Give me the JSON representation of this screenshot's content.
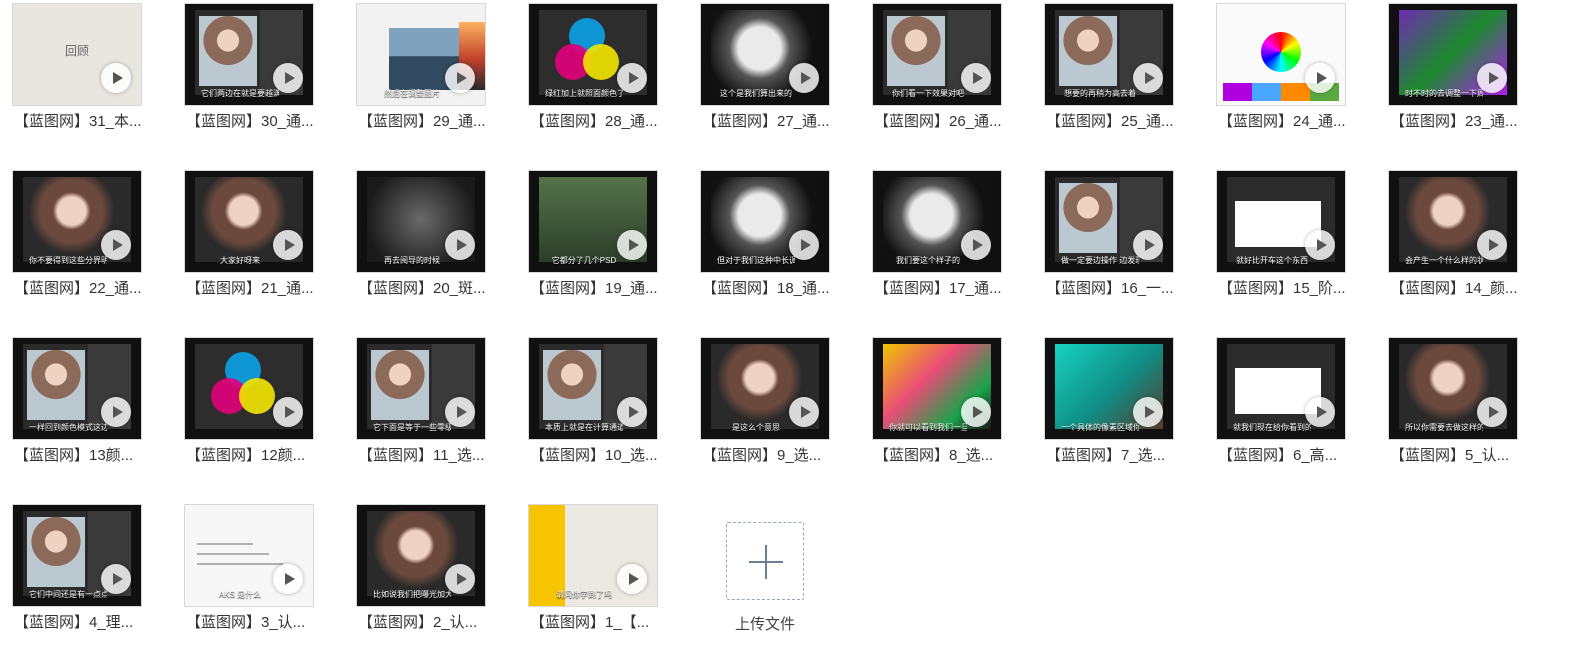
{
  "files": [
    {
      "label": "【蓝图网】31_本...",
      "caption": "",
      "title": "回顾",
      "variant": "v-blank"
    },
    {
      "label": "【蓝图网】30_通...",
      "caption": "它们两边在就是要越满的 越来越薄了",
      "variant": "v-ps"
    },
    {
      "label": "【蓝图网】29_通...",
      "caption": "然后在调整图片",
      "variant": "v-web"
    },
    {
      "label": "【蓝图网】28_通...",
      "caption": "绿红加上就照面颜色了",
      "variant": "v-rgb"
    },
    {
      "label": "【蓝图网】27_通...",
      "caption": "这个是我们算出来的",
      "variant": "v-bw"
    },
    {
      "label": "【蓝图网】26_通...",
      "caption": "你们看一下效果对吧",
      "variant": "v-ps"
    },
    {
      "label": "【蓝图网】25_通...",
      "caption": "想要的再稍为高去着",
      "variant": "v-ps"
    },
    {
      "label": "【蓝图网】24_通...",
      "caption": "",
      "variant": "v-wheel"
    },
    {
      "label": "【蓝图网】23_通...",
      "caption": "时不时的去调整一下周边的颜色",
      "variant": "v-green"
    },
    {
      "label": "【蓝图网】22_通...",
      "caption": "你不要得到这些分界明显的地方",
      "variant": "v-portrait"
    },
    {
      "label": "【蓝图网】21_通...",
      "caption": "大家好呀来",
      "variant": "v-portrait"
    },
    {
      "label": "【蓝图网】20_斑...",
      "caption": "再去阅导的时候",
      "variant": "v-noise"
    },
    {
      "label": "【蓝图网】19_通...",
      "caption": "它都分了几个PSD",
      "variant": "v-forest"
    },
    {
      "label": "【蓝图网】18_通...",
      "caption": "但对于我们这种中长调来说你不同",
      "variant": "v-bw"
    },
    {
      "label": "【蓝图网】17_通...",
      "caption": "我们要这个样子的",
      "variant": "v-bw"
    },
    {
      "label": "【蓝图网】16_一...",
      "caption": "做一定要边操作 边发现问题",
      "variant": "v-ps"
    },
    {
      "label": "【蓝图网】15_阶...",
      "caption": "就好比开车这个东西",
      "variant": "v-white"
    },
    {
      "label": "【蓝图网】14_颜...",
      "caption": "会产生一个什么样的状态",
      "variant": "v-portrait"
    },
    {
      "label": "【蓝图网】13颜...",
      "caption": "一样回到颜色模式这边",
      "variant": "v-ps"
    },
    {
      "label": "【蓝图网】12颜...",
      "caption": "",
      "variant": "v-rgb"
    },
    {
      "label": "【蓝图网】11_选...",
      "caption": "它下面是等于一些零级的",
      "variant": "v-ps"
    },
    {
      "label": "【蓝图网】10_选...",
      "caption": "本质上就是在计算通道里面的亮度",
      "variant": "v-ps"
    },
    {
      "label": "【蓝图网】9_选...",
      "caption": "是这么个意思",
      "variant": "v-portrait"
    },
    {
      "label": "【蓝图网】8_选...",
      "caption": "你就可以看到我们一旦放",
      "variant": "v-colorful"
    },
    {
      "label": "【蓝图网】7_选...",
      "caption": "一个具体的像素区域你就读懂了",
      "variant": "v-teal"
    },
    {
      "label": "【蓝图网】6_高...",
      "caption": "就我们现在给你看到的这张",
      "variant": "v-white"
    },
    {
      "label": "【蓝图网】5_认...",
      "caption": "所以你需要去做这样的无效",
      "variant": "v-portrait"
    },
    {
      "label": "【蓝图网】4_理...",
      "caption": "它们中间还是有一点点的距离的",
      "variant": "v-ps"
    },
    {
      "label": "【蓝图网】3_认...",
      "caption": "AKS 是什么",
      "variant": "v-doc"
    },
    {
      "label": "【蓝图网】2_认...",
      "caption": "比如说我们把曝光加大的时候",
      "variant": "v-portrait"
    },
    {
      "label": "【蓝图网】1_【...",
      "caption": "请问你学到了吗",
      "variant": "v-yellow"
    }
  ],
  "upload": {
    "label": "上传文件"
  }
}
